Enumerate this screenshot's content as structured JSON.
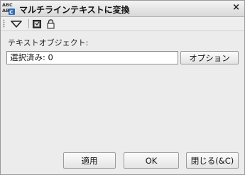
{
  "window": {
    "title": "マルチラインテキストに変換",
    "close_glyph": "×",
    "app_icon": "abc-text-convert-icon"
  },
  "toolbar": {
    "items": [
      {
        "icon": "triangle-dropdown-icon"
      },
      {
        "icon": "select-objects-icon"
      },
      {
        "icon": "lock-icon"
      }
    ]
  },
  "form": {
    "text_object_label": "テキストオブジェクト:",
    "selection_value": "選択済み: 0",
    "options_button": "オプション"
  },
  "footer": {
    "apply_button": "適用",
    "ok_button": "OK",
    "close_button": "閉じる(&C)"
  },
  "colors": {
    "titlebar_start": "#f4f4f4",
    "titlebar_end": "#d8d8d8",
    "window_bg": "#ececec",
    "icon_blue": "#2f6fb8"
  }
}
